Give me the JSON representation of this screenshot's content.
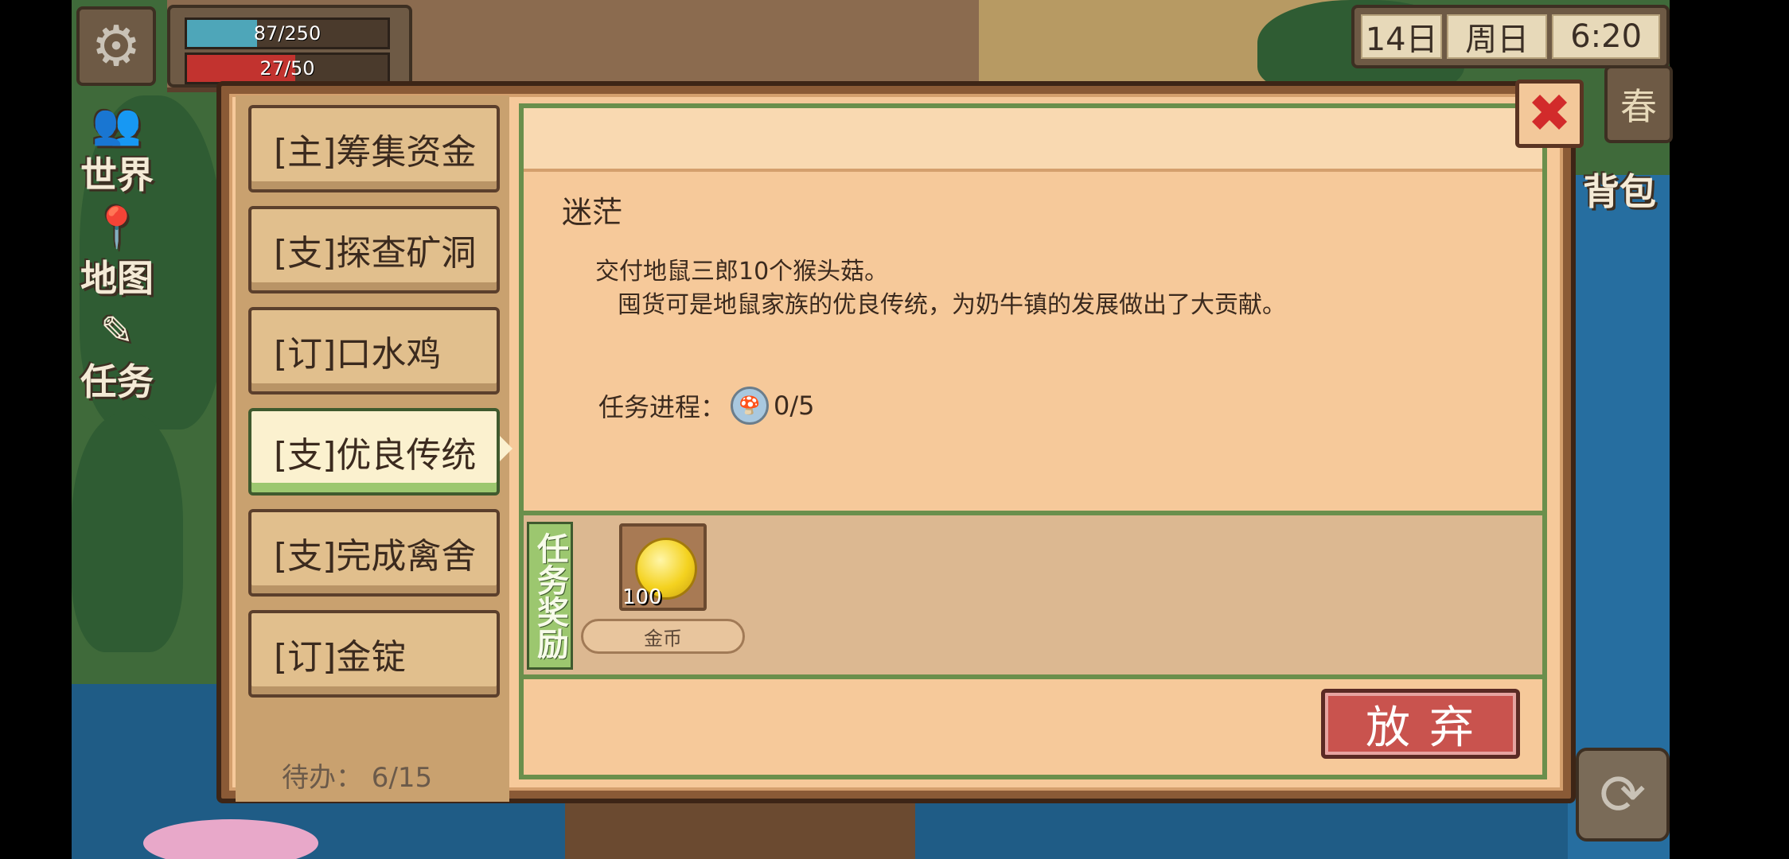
{
  "hud": {
    "hp_text": "87/250",
    "hp_fraction": 0.348,
    "energy_text": "27/50",
    "energy_fraction": 0.54,
    "date_day": "14日",
    "date_week": "周日",
    "time": "6:20",
    "season": "春"
  },
  "side_menu": {
    "world": "世界",
    "map": "地图",
    "task": "任务",
    "bag": "背包"
  },
  "quest_list": [
    "[主]筹集资金",
    "[支]探查矿洞",
    "[订]口水鸡",
    "[支]优良传统",
    "[支]完成禽舍",
    "[订]金锭"
  ],
  "selected_index": 3,
  "todo": "待办：  6/15",
  "quest_detail": {
    "title": "迷茫",
    "desc1": "交付地鼠三郎10个猴头菇。",
    "desc2": "囤货可是地鼠家族的优良传统，为奶牛镇的发展做出了大贡献。",
    "progress_label": "任务进程：",
    "progress_value": "0/5",
    "reward_section_label": "任务奖励",
    "reward_qty": "100",
    "reward_name": "金币",
    "abandon_label": "放弃"
  },
  "icons": {
    "gear": "gear-icon",
    "close": "close-icon",
    "coin": "gold-coin-icon",
    "refresh": "refresh-icon"
  }
}
